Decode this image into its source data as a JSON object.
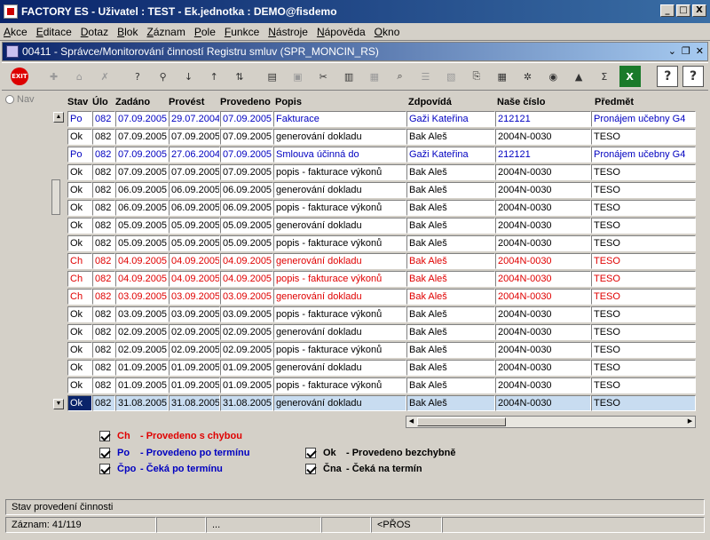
{
  "title": "FACTORY ES - Uživatel : TEST - Ek.jednotka : DEMO@fisdemo",
  "window_buttons": [
    "_",
    "□",
    "X"
  ],
  "menu": [
    "Akce",
    "Editace",
    "Dotaz",
    "Blok",
    "Záznam",
    "Pole",
    "Funkce",
    "Nástroje",
    "Nápověda",
    "Okno"
  ],
  "subwindow": {
    "title": "00411 - Správce/Monitorování činností Registru smluv (SPR_MONCIN_RS)"
  },
  "toolbar": {
    "exit_label": "EXIT",
    "icons": [
      "exit-icon",
      "insert-record-icon",
      "save-icon",
      "delete-icon",
      "query-enter-icon",
      "query-execute-icon",
      "sort-ascending-icon",
      "sort-descending-icon",
      "sort-multi-icon",
      "print-icon",
      "copy-icon",
      "cut-icon",
      "paste-icon",
      "disabled-icon",
      "search-icon",
      "list-icon",
      "disabled-icon-2",
      "attachment-icon",
      "calculator-icon",
      "control-wheel-icon",
      "eye-icon",
      "mountains-icon",
      "sum-icon",
      "excel-icon",
      "help-icon",
      "context-help-icon"
    ]
  },
  "nav_label": "Nav",
  "columns": [
    "Stav",
    "Úlo",
    "Zadáno",
    "Provést",
    "Provedeno",
    "Popis",
    "Zdpovídá",
    "Naše číslo",
    "Předmět"
  ],
  "rows": [
    {
      "color": "blue",
      "c": [
        "Po",
        "082",
        "07.09.2005",
        "29.07.2004",
        "07.09.2005",
        "Fakturace",
        "Gaži Kateřina",
        "212121",
        "Pronájem učebny G4"
      ]
    },
    {
      "color": "black",
      "c": [
        "Ok",
        "082",
        "07.09.2005",
        "07.09.2005",
        "07.09.2005",
        "generování dokladu",
        "Bak Aleš",
        "2004N-0030",
        "TESO"
      ]
    },
    {
      "color": "blue",
      "c": [
        "Po",
        "082",
        "07.09.2005",
        "27.06.2004",
        "07.09.2005",
        "Smlouva účinná do",
        "Gaži Kateřina",
        "212121",
        "Pronájem učebny G4"
      ]
    },
    {
      "color": "black",
      "c": [
        "Ok",
        "082",
        "07.09.2005",
        "07.09.2005",
        "07.09.2005",
        "popis - fakturace výkonů",
        "Bak Aleš",
        "2004N-0030",
        "TESO"
      ]
    },
    {
      "color": "black",
      "c": [
        "Ok",
        "082",
        "06.09.2005",
        "06.09.2005",
        "06.09.2005",
        "generování dokladu",
        "Bak Aleš",
        "2004N-0030",
        "TESO"
      ]
    },
    {
      "color": "black",
      "c": [
        "Ok",
        "082",
        "06.09.2005",
        "06.09.2005",
        "06.09.2005",
        "popis - fakturace výkonů",
        "Bak Aleš",
        "2004N-0030",
        "TESO"
      ]
    },
    {
      "color": "black",
      "c": [
        "Ok",
        "082",
        "05.09.2005",
        "05.09.2005",
        "05.09.2005",
        "generování dokladu",
        "Bak Aleš",
        "2004N-0030",
        "TESO"
      ]
    },
    {
      "color": "black",
      "c": [
        "Ok",
        "082",
        "05.09.2005",
        "05.09.2005",
        "05.09.2005",
        "popis - fakturace výkonů",
        "Bak Aleš",
        "2004N-0030",
        "TESO"
      ]
    },
    {
      "color": "red",
      "c": [
        "Ch",
        "082",
        "04.09.2005",
        "04.09.2005",
        "04.09.2005",
        "generování dokladu",
        "Bak Aleš",
        "2004N-0030",
        "TESO"
      ]
    },
    {
      "color": "red",
      "c": [
        "Ch",
        "082",
        "04.09.2005",
        "04.09.2005",
        "04.09.2005",
        "popis - fakturace výkonů",
        "Bak Aleš",
        "2004N-0030",
        "TESO"
      ]
    },
    {
      "color": "red",
      "c": [
        "Ch",
        "082",
        "03.09.2005",
        "03.09.2005",
        "03.09.2005",
        "generování dokladu",
        "Bak Aleš",
        "2004N-0030",
        "TESO"
      ]
    },
    {
      "color": "black",
      "c": [
        "Ok",
        "082",
        "03.09.2005",
        "03.09.2005",
        "03.09.2005",
        "popis - fakturace výkonů",
        "Bak Aleš",
        "2004N-0030",
        "TESO"
      ]
    },
    {
      "color": "black",
      "c": [
        "Ok",
        "082",
        "02.09.2005",
        "02.09.2005",
        "02.09.2005",
        "generování dokladu",
        "Bak Aleš",
        "2004N-0030",
        "TESO"
      ]
    },
    {
      "color": "black",
      "c": [
        "Ok",
        "082",
        "02.09.2005",
        "02.09.2005",
        "02.09.2005",
        "popis - fakturace výkonů",
        "Bak Aleš",
        "2004N-0030",
        "TESO"
      ]
    },
    {
      "color": "black",
      "c": [
        "Ok",
        "082",
        "01.09.2005",
        "01.09.2005",
        "01.09.2005",
        "generování dokladu",
        "Bak Aleš",
        "2004N-0030",
        "TESO"
      ]
    },
    {
      "color": "black",
      "c": [
        "Ok",
        "082",
        "01.09.2005",
        "01.09.2005",
        "01.09.2005",
        "popis - fakturace výkonů",
        "Bak Aleš",
        "2004N-0030",
        "TESO"
      ]
    },
    {
      "color": "black",
      "selected": true,
      "c": [
        "Ok",
        "082",
        "31.08.2005",
        "31.08.2005",
        "31.08.2005",
        "generování dokladu",
        "Bak Aleš",
        "2004N-0030",
        "TESO"
      ]
    }
  ],
  "legend": {
    "ch": {
      "code": "Ch",
      "text": "- Provedeno s chybou",
      "color": "#e00000"
    },
    "po": {
      "code": "Po",
      "text": "- Provedeno po termínu",
      "color": "#0000c0"
    },
    "cpo": {
      "code": "Čpo",
      "text": "- Čeká po termínu",
      "color": "#0000c0"
    },
    "ok": {
      "code": "Ok",
      "text": "- Provedeno bezchybně",
      "color": "#000000"
    },
    "cna": {
      "code": "Čna",
      "text": "- Čeká na termín",
      "color": "#000000"
    }
  },
  "status_text": "Stav provedení činnosti",
  "statusbar": {
    "record": "Záznam: 41/119",
    "seg2": "",
    "seg3": "...",
    "seg4": "",
    "mode": "<PŘOS",
    "seg6": ""
  },
  "colors": {
    "title_bar": "#0a246a",
    "blue_status": "#0000c0",
    "red_status": "#e00000",
    "selected_row": "#c8dcf0"
  }
}
